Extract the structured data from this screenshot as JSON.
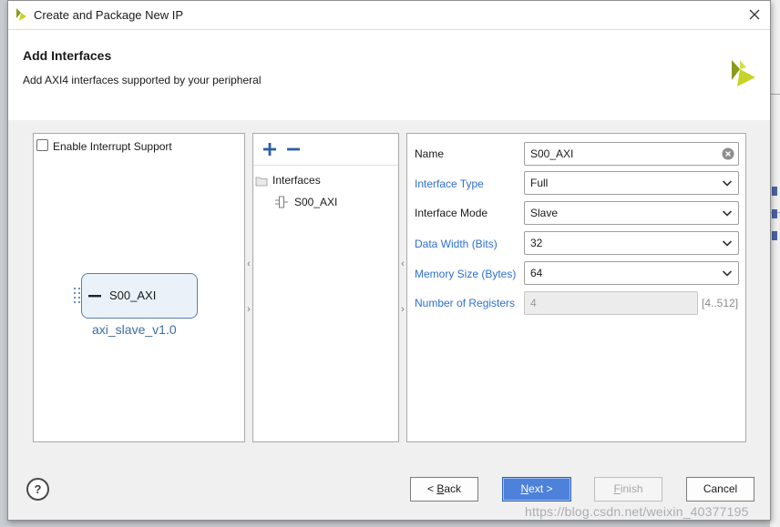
{
  "window": {
    "title": "Create and Package New IP"
  },
  "header": {
    "title": "Add Interfaces",
    "subtitle": "Add AXI4 interfaces supported by your peripheral"
  },
  "left_panel": {
    "interrupt_checkbox_label": "Enable Interrupt Support",
    "interrupt_checked": false,
    "block_port_label": "S00_AXI",
    "block_name": "axi_slave_v1.0"
  },
  "interfaces_panel": {
    "root_label": "Interfaces",
    "items": [
      "S00_AXI"
    ]
  },
  "properties": {
    "name": {
      "label": "Name",
      "value": "S00_AXI"
    },
    "interface_type": {
      "label": "Interface Type",
      "value": "Full"
    },
    "interface_mode": {
      "label": "Interface Mode",
      "value": "Slave"
    },
    "data_width": {
      "label": "Data Width (Bits)",
      "value": "32"
    },
    "memory_size": {
      "label": "Memory Size (Bytes)",
      "value": "64"
    },
    "num_registers": {
      "label": "Number of Registers",
      "value": "4",
      "range": "[4..512]"
    }
  },
  "footer": {
    "help_label": "?",
    "back": {
      "prefix": "< ",
      "accel": "B",
      "rest": "ack"
    },
    "next": {
      "accel": "N",
      "rest": "ext >"
    },
    "finish": {
      "accel": "F",
      "rest": "inish"
    },
    "cancel_label": "Cancel"
  },
  "watermark": "https://blog.csdn.net/weixin_40377195",
  "colors": {
    "accent": "#4e81d9",
    "link_label": "#2f6fd1",
    "block_fill": "#eaf1f8",
    "logo": "#b7c21c"
  },
  "icons": [
    "vivado-logo-icon",
    "close-icon",
    "add-icon",
    "remove-icon",
    "folder-icon",
    "interface-icon",
    "clear-icon",
    "chevron-down-icon",
    "help-icon"
  ]
}
